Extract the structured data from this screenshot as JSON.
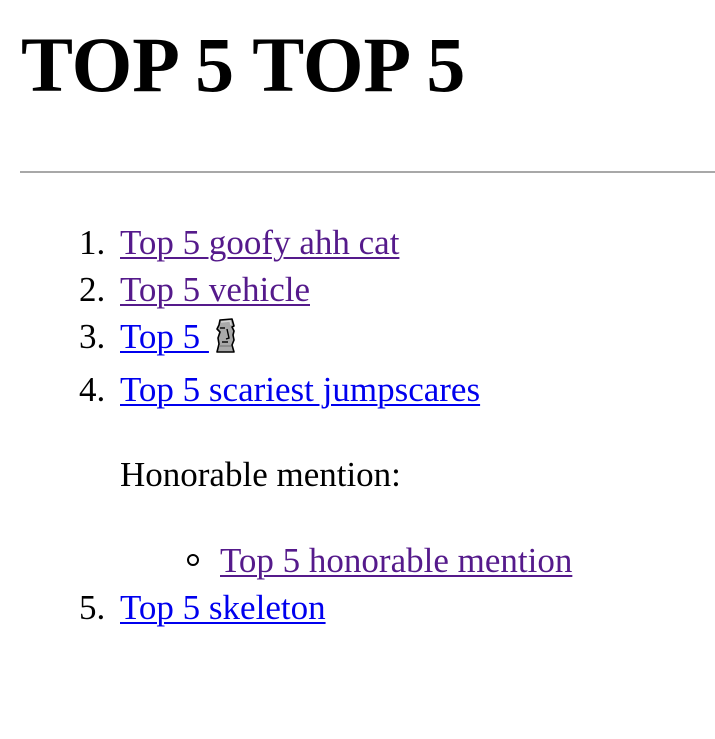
{
  "page": {
    "title": "TOP 5 TOP 5"
  },
  "list": {
    "items": [
      {
        "marker": "1.",
        "label": "Top 5 goofy ahh cat"
      },
      {
        "marker": "2.",
        "label": "Top 5 vehicle"
      },
      {
        "marker": "3.",
        "label": "Top 5 ",
        "icon": "moai-icon"
      },
      {
        "marker": "4.",
        "label": "Top 5 scariest jumpscares"
      },
      {
        "marker": "5.",
        "label": "Top 5 skeleton"
      }
    ],
    "honorable_heading": "Honorable mention:",
    "honorable_items": [
      {
        "label": "Top 5 honorable mention"
      }
    ]
  },
  "colors": {
    "visited_link": "#551a8b",
    "unvisited_link": "#0000ee",
    "divider": "#a8a8a8"
  }
}
